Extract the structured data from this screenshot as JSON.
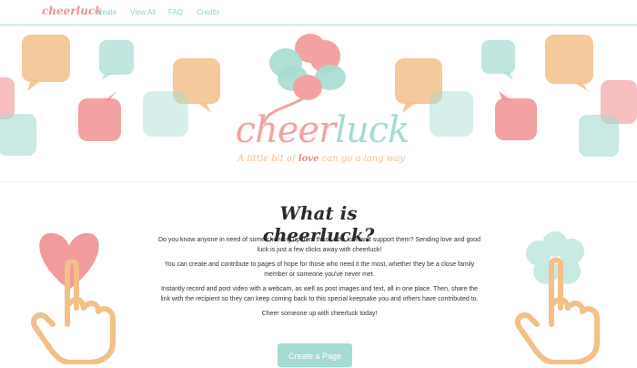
{
  "navbar": {
    "brand": "cheerluck",
    "links": [
      "Create",
      "View All",
      "FAQ",
      "Credits"
    ]
  },
  "hero": {
    "logo_cheer": "cheer",
    "logo_luck": "luck",
    "tagline_before": "A little bit of ",
    "tagline_love": "love",
    "tagline_after": " can go a long way"
  },
  "main": {
    "title": "What is cheerluck?",
    "paragraphs": [
      "Do you know anyone in need of some cheering up from those who love and support them? Sending love and good luck is just a few clicks away with cheerluck!",
      "You can create and contribute to pages of hope for those who need it the most, whether they be a close family member or someone you've never met.",
      "Instantly record and post video with a webcam, as well as post images and text, all in one place. Then, share the link with the recipient so they can keep coming back to this special keepsake you and others have contributed to.",
      "Cheer someone up with cheerluck today!"
    ],
    "cta_label": "Create a Page"
  },
  "colors": {
    "pink": "#f2908f",
    "mint": "#a6dbd2",
    "peach": "#f2c089"
  }
}
